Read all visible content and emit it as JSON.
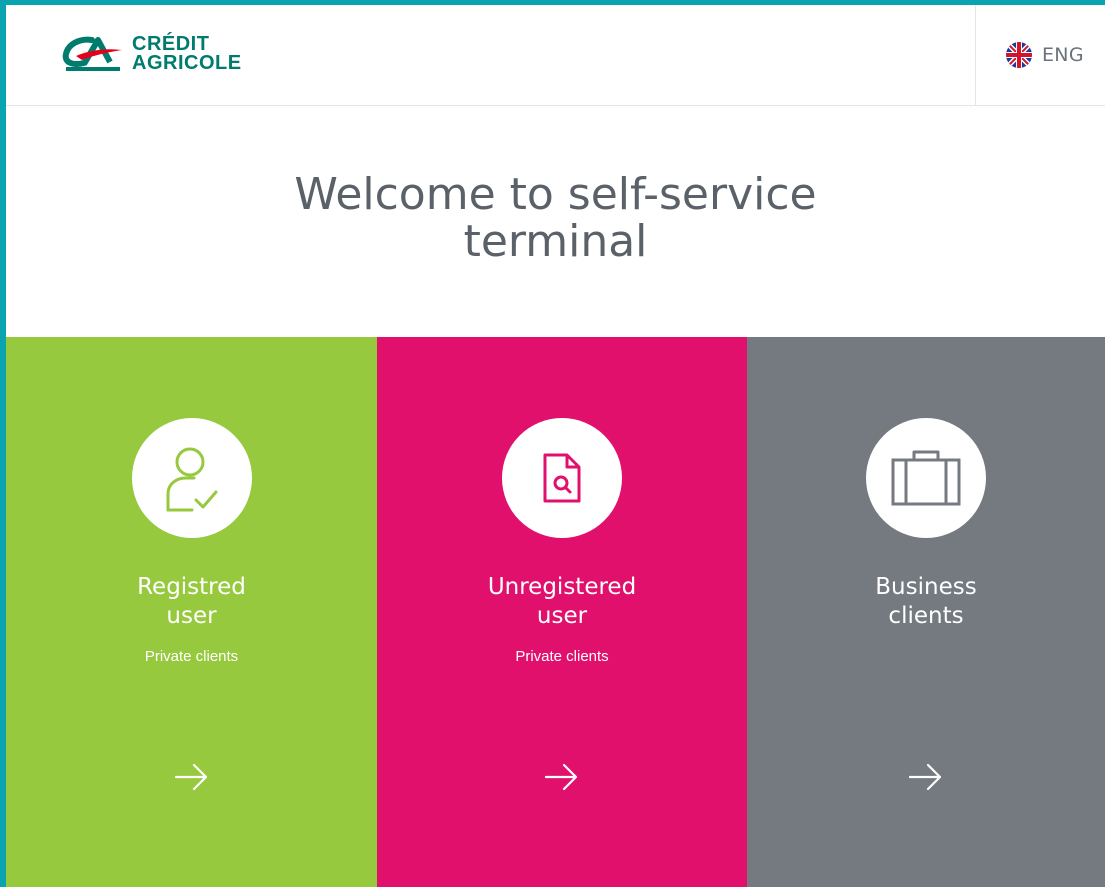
{
  "header": {
    "logo": {
      "line1": "CRÉDIT",
      "line2": "AGRICOLE"
    },
    "language": {
      "label": "ENG",
      "icon": "uk-flag-icon"
    }
  },
  "welcome": {
    "line1": "Welcome to self-service",
    "line2": "terminal"
  },
  "tiles": [
    {
      "title_line1": "Registred",
      "title_line2": "user",
      "subtitle": "Private clients",
      "icon": "user-check-icon",
      "color": "#96c93d"
    },
    {
      "title_line1": "Unregistered",
      "title_line2": "user",
      "subtitle": "Private clients",
      "icon": "document-search-icon",
      "color": "#e2106d"
    },
    {
      "title_line1": "Business",
      "title_line2": "clients",
      "subtitle": "",
      "icon": "briefcase-icon",
      "color": "#747a80"
    }
  ],
  "colors": {
    "frame": "#0aa3b0",
    "brand_green": "#007c6e",
    "brand_red": "#e2001a"
  }
}
